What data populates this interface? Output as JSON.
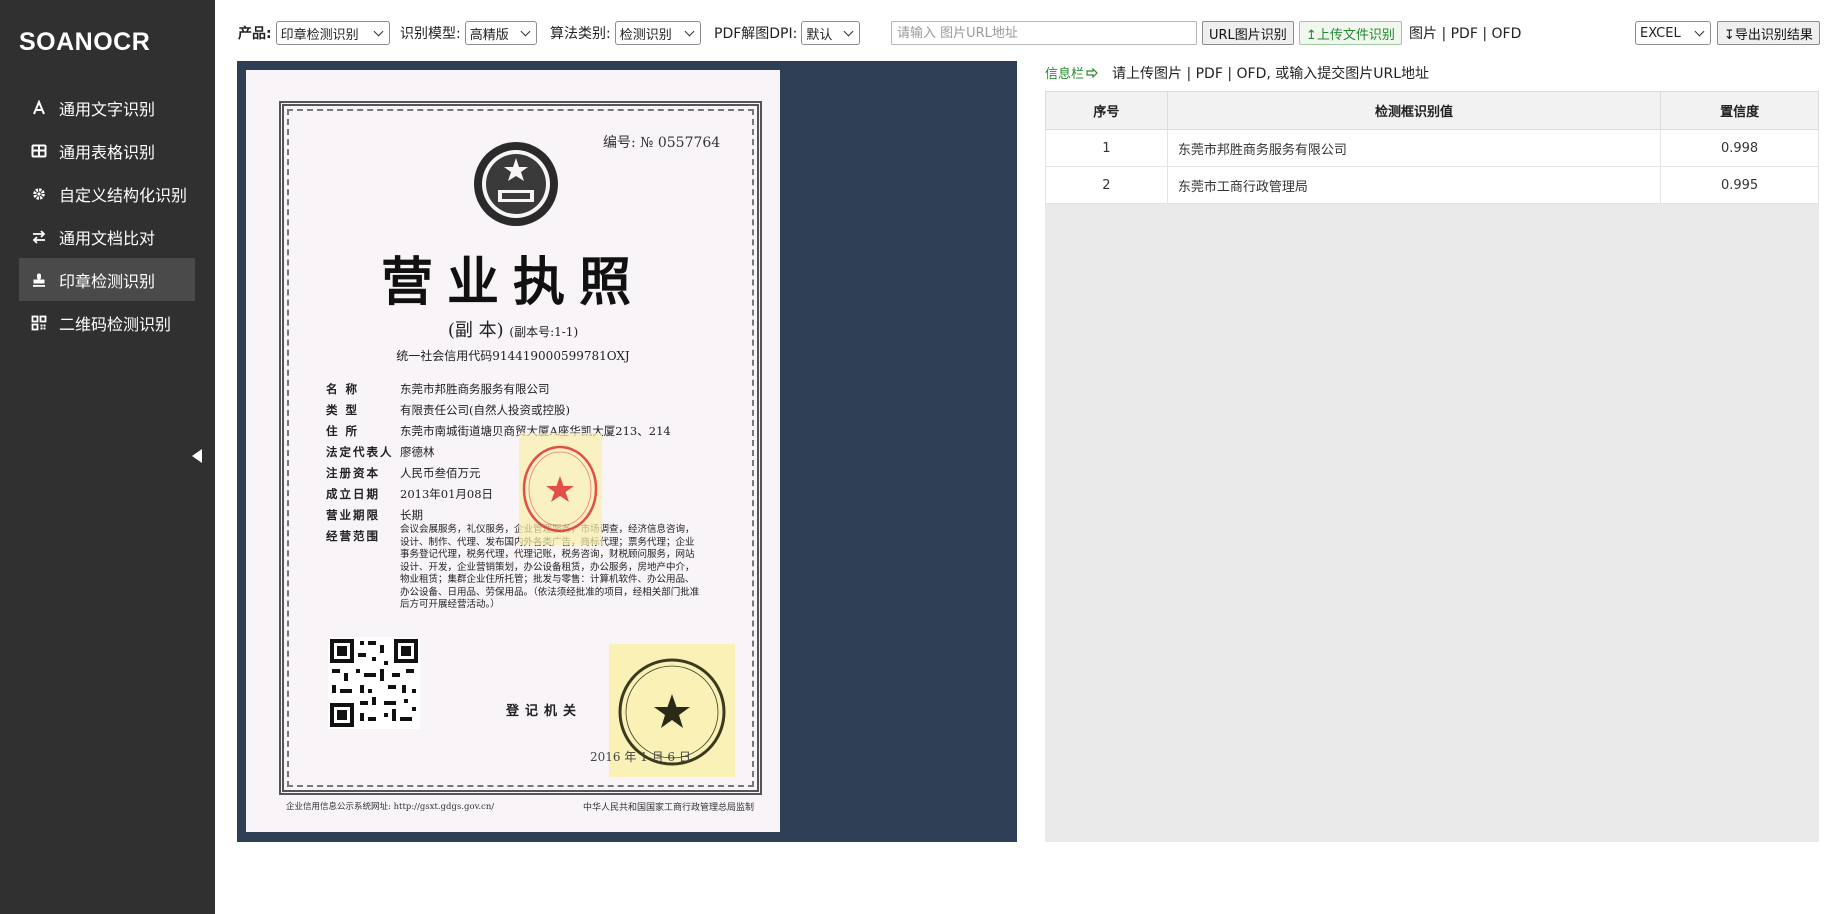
{
  "app": {
    "logo": "SOANOCR"
  },
  "sidebar": {
    "items": [
      {
        "label": "通用文字识别",
        "icon": "text-icon",
        "active": false
      },
      {
        "label": "通用表格识别",
        "icon": "table-icon",
        "active": false
      },
      {
        "label": "自定义结构化识别",
        "icon": "gear-icon",
        "active": false
      },
      {
        "label": "通用文档比对",
        "icon": "swap-icon",
        "active": false
      },
      {
        "label": "印章检测识别",
        "icon": "stamp-icon",
        "active": true
      },
      {
        "label": "二维码检测识别",
        "icon": "qrcode-icon",
        "active": false
      }
    ]
  },
  "toolbar": {
    "product_label": "产品:",
    "product_value": "印章检测识别",
    "model_label": "识别模型:",
    "model_value": "高精版",
    "algo_label": "算法类别:",
    "algo_value": "检测识别",
    "dpi_label": "PDF解图DPI:",
    "dpi_value": "默认",
    "url_placeholder": "请输入 图片URL地址",
    "url_button": "URL图片识别",
    "upload_button": "↥上传文件识别",
    "formats": "图片 | PDF | OFD",
    "export_format": "EXCEL",
    "export_button": "↧导出识别结果"
  },
  "document": {
    "number": "编号: № 0557764",
    "title": "营业执照",
    "subtitle": "(副 本)",
    "subtitle_small": "(副本号:1-1)",
    "credit_code": "统一社会信用代码914419000599781OXJ",
    "fields": [
      {
        "key": "名    称",
        "value": "东莞市邦胜商务服务有限公司"
      },
      {
        "key": "类    型",
        "value": "有限责任公司(自然人投资或控股)"
      },
      {
        "key": "住    所",
        "value": "东莞市南城街道塘贝商贸大厦A座华凯大厦213、214"
      },
      {
        "key": "法定代表人",
        "value": "廖德林"
      },
      {
        "key": "注册资本",
        "value": "人民币叁佰万元"
      },
      {
        "key": "成立日期",
        "value": "2013年01月08日"
      },
      {
        "key": "营业期限",
        "value": "长期"
      },
      {
        "key": "经营范围",
        "value": ""
      }
    ],
    "scope": "会议会展服务，礼仪服务，企业管理服务，市场调查，经济信息咨询，设计、制作、代理、发布国内外各类广告，商标代理；票务代理；企业事务登记代理，税务代理，代理记账，税务咨询，财税顾问服务，网站设计、开发，企业营销策划，办公设备租赁，办公服务，房地产中介，物业租赁；集群企业住所托管；批发与零售：计算机软件、办公用品、办公设备、日用品、劳保用品。（依法须经批准的项目，经相关部门批准后方可开展经营活动。）",
    "authority": "登记机关",
    "date": "2016 年 1 月 6 日",
    "footer_left": "企业信用信息公示系统网址:    http://gsxt.gdgs.gov.cn/",
    "footer_right": "中华人民共和国国家工商行政管理总局监制",
    "stamp1_text": "东莞市邦胜商务服务有限公司",
    "stamp2_text": "东莞市工商行政管理局"
  },
  "info": {
    "label": "信息栏",
    "message": "请上传图片 | PDF | OFD, 或输入提交图片URL地址"
  },
  "results": {
    "headers": {
      "index": "序号",
      "value": "检测框识别值",
      "confidence": "置信度"
    },
    "rows": [
      {
        "index": "1",
        "value": "东莞市邦胜商务服务有限公司",
        "confidence": "0.998"
      },
      {
        "index": "2",
        "value": "东莞市工商行政管理局",
        "confidence": "0.995"
      }
    ]
  },
  "colors": {
    "sidebar_bg": "#303030",
    "image_panel_bg": "#2d3e55",
    "accent_green": "#2a8a2f",
    "stamp_red": "#d33",
    "stamp_dark": "#3a3a20"
  }
}
